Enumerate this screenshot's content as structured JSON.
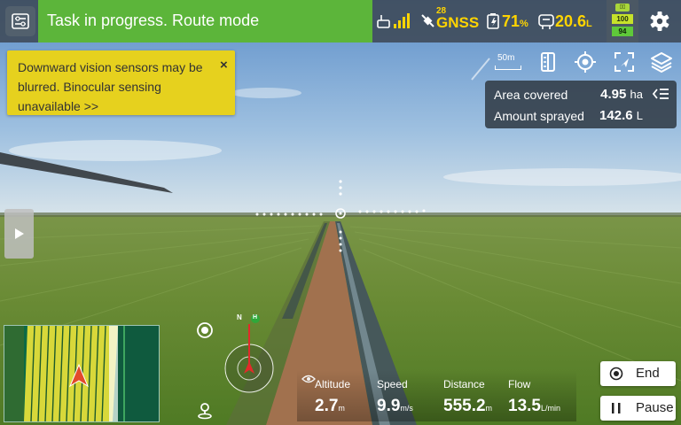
{
  "status_bar": {
    "task_status": "Task in progress. Route mode",
    "gnss_satellites": "28",
    "gnss_label": "GNSS",
    "battery_percent": "71",
    "battery_unit": "%",
    "tank_level": "20.6",
    "tank_unit": "L",
    "battery_a_level": "100",
    "battery_b_level": "94",
    "icons": [
      "menu-icon",
      "remote-signal-icon",
      "satellite-icon",
      "battery-icon",
      "tank-icon",
      "dual-battery-icon",
      "settings-icon"
    ]
  },
  "warning": {
    "text": "Downward vision sensors may be blurred. Binocular sensing unavailable >>",
    "close_label": "×"
  },
  "map_tools": {
    "scale_label": "50m",
    "icons": [
      "route-map-icon",
      "locate-icon",
      "focus-target-icon",
      "layers-icon"
    ]
  },
  "stats": {
    "area_label": "Area covered",
    "area_value": "4.95",
    "area_unit": "ha",
    "sprayed_label": "Amount sprayed",
    "sprayed_value": "142.6",
    "sprayed_unit": "L"
  },
  "compass": {
    "north_label": "N",
    "home_label": "H"
  },
  "telemetry": {
    "altitude_label": "Altitude",
    "altitude_value": "2.7",
    "altitude_unit": "m",
    "speed_label": "Speed",
    "speed_value": "9.9",
    "speed_unit": "m/s",
    "distance_label": "Distance",
    "distance_value": "555.2",
    "distance_unit": "m",
    "flow_label": "Flow",
    "flow_value": "13.5",
    "flow_unit": "L/min"
  },
  "actions": {
    "end_label": "End",
    "pause_label": "Pause"
  },
  "colors": {
    "status_green": "#5cb53a",
    "warning_yellow": "#e6d11e",
    "accent_yellow": "#ffd400"
  }
}
